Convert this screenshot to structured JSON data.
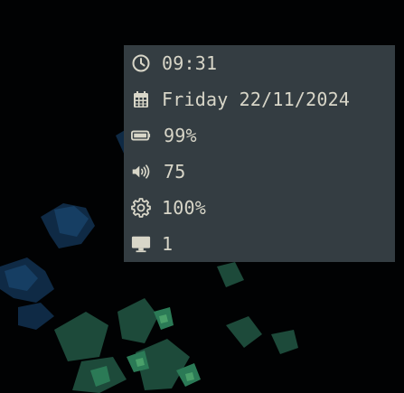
{
  "status_panel": {
    "time": {
      "icon": "clock-icon",
      "value": "09:31"
    },
    "date": {
      "icon": "calendar-icon",
      "value": "Friday 22/11/2024"
    },
    "battery": {
      "icon": "battery-icon",
      "value": "99%"
    },
    "volume": {
      "icon": "volume-icon",
      "value": "75"
    },
    "brightness": {
      "icon": "gear-icon",
      "value": "100%"
    },
    "workspace": {
      "icon": "monitor-icon",
      "value": "1"
    }
  },
  "colors": {
    "panel_background": "#343d42",
    "text": "#d8d6c8",
    "desktop_background": "#010203"
  }
}
